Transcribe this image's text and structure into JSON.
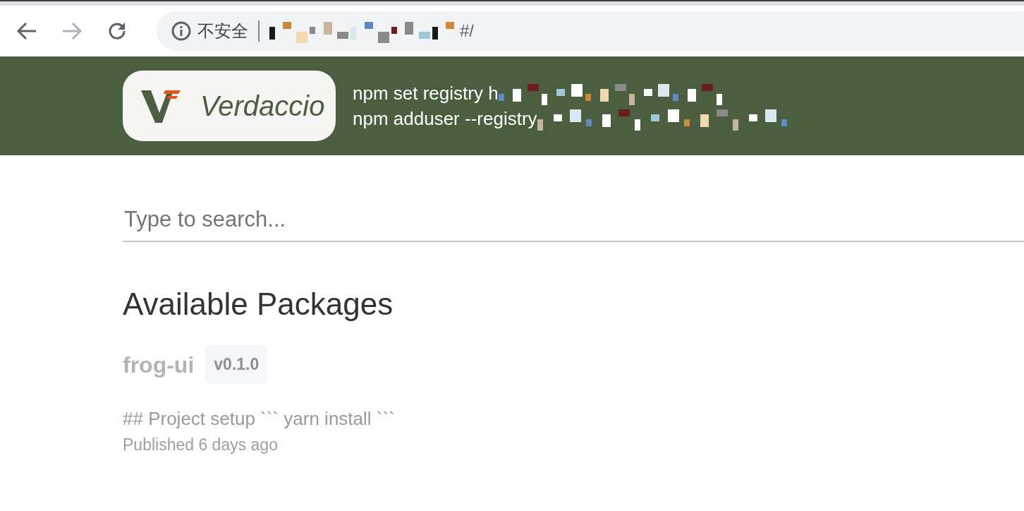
{
  "browser": {
    "security_label": "不安全",
    "url_tail": "#/"
  },
  "header": {
    "logo_text": "Verdaccio",
    "commands": [
      "npm set registry h",
      "npm adduser --registry"
    ]
  },
  "search": {
    "placeholder": "Type to search..."
  },
  "heading": "Available Packages",
  "packages": [
    {
      "name": "frog-ui",
      "version": "v0.1.0",
      "description": "## Project setup ``` yarn install ```",
      "published": "Published 6 days ago"
    }
  ]
}
